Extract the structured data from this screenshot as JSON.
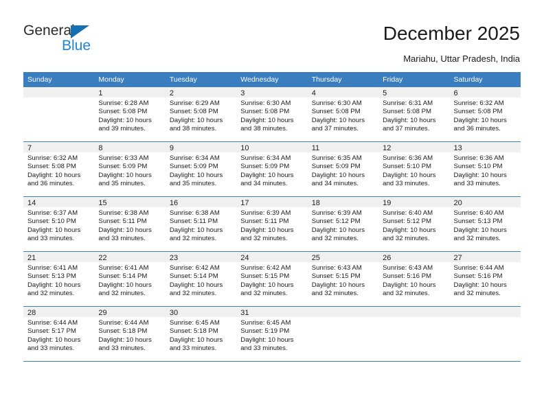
{
  "brand": {
    "name_top": "General",
    "name_bottom": "Blue",
    "accent_color": "#1b85d6",
    "triangle_color": "#146fb4"
  },
  "header": {
    "title": "December 2025",
    "subtitle": "Mariahu, Uttar Pradesh, India"
  },
  "calendar": {
    "header_color": "#3a7ebf",
    "weekday_headers": [
      "Sunday",
      "Monday",
      "Tuesday",
      "Wednesday",
      "Thursday",
      "Friday",
      "Saturday"
    ],
    "weeks": [
      [
        {
          "day": "",
          "sunrise": "",
          "sunset": "",
          "daylight": ""
        },
        {
          "day": "1",
          "sunrise": "Sunrise: 6:28 AM",
          "sunset": "Sunset: 5:08 PM",
          "daylight": "Daylight: 10 hours and 39 minutes."
        },
        {
          "day": "2",
          "sunrise": "Sunrise: 6:29 AM",
          "sunset": "Sunset: 5:08 PM",
          "daylight": "Daylight: 10 hours and 38 minutes."
        },
        {
          "day": "3",
          "sunrise": "Sunrise: 6:30 AM",
          "sunset": "Sunset: 5:08 PM",
          "daylight": "Daylight: 10 hours and 38 minutes."
        },
        {
          "day": "4",
          "sunrise": "Sunrise: 6:30 AM",
          "sunset": "Sunset: 5:08 PM",
          "daylight": "Daylight: 10 hours and 37 minutes."
        },
        {
          "day": "5",
          "sunrise": "Sunrise: 6:31 AM",
          "sunset": "Sunset: 5:08 PM",
          "daylight": "Daylight: 10 hours and 37 minutes."
        },
        {
          "day": "6",
          "sunrise": "Sunrise: 6:32 AM",
          "sunset": "Sunset: 5:08 PM",
          "daylight": "Daylight: 10 hours and 36 minutes."
        }
      ],
      [
        {
          "day": "7",
          "sunrise": "Sunrise: 6:32 AM",
          "sunset": "Sunset: 5:08 PM",
          "daylight": "Daylight: 10 hours and 36 minutes."
        },
        {
          "day": "8",
          "sunrise": "Sunrise: 6:33 AM",
          "sunset": "Sunset: 5:09 PM",
          "daylight": "Daylight: 10 hours and 35 minutes."
        },
        {
          "day": "9",
          "sunrise": "Sunrise: 6:34 AM",
          "sunset": "Sunset: 5:09 PM",
          "daylight": "Daylight: 10 hours and 35 minutes."
        },
        {
          "day": "10",
          "sunrise": "Sunrise: 6:34 AM",
          "sunset": "Sunset: 5:09 PM",
          "daylight": "Daylight: 10 hours and 34 minutes."
        },
        {
          "day": "11",
          "sunrise": "Sunrise: 6:35 AM",
          "sunset": "Sunset: 5:09 PM",
          "daylight": "Daylight: 10 hours and 34 minutes."
        },
        {
          "day": "12",
          "sunrise": "Sunrise: 6:36 AM",
          "sunset": "Sunset: 5:10 PM",
          "daylight": "Daylight: 10 hours and 33 minutes."
        },
        {
          "day": "13",
          "sunrise": "Sunrise: 6:36 AM",
          "sunset": "Sunset: 5:10 PM",
          "daylight": "Daylight: 10 hours and 33 minutes."
        }
      ],
      [
        {
          "day": "14",
          "sunrise": "Sunrise: 6:37 AM",
          "sunset": "Sunset: 5:10 PM",
          "daylight": "Daylight: 10 hours and 33 minutes."
        },
        {
          "day": "15",
          "sunrise": "Sunrise: 6:38 AM",
          "sunset": "Sunset: 5:11 PM",
          "daylight": "Daylight: 10 hours and 33 minutes."
        },
        {
          "day": "16",
          "sunrise": "Sunrise: 6:38 AM",
          "sunset": "Sunset: 5:11 PM",
          "daylight": "Daylight: 10 hours and 32 minutes."
        },
        {
          "day": "17",
          "sunrise": "Sunrise: 6:39 AM",
          "sunset": "Sunset: 5:11 PM",
          "daylight": "Daylight: 10 hours and 32 minutes."
        },
        {
          "day": "18",
          "sunrise": "Sunrise: 6:39 AM",
          "sunset": "Sunset: 5:12 PM",
          "daylight": "Daylight: 10 hours and 32 minutes."
        },
        {
          "day": "19",
          "sunrise": "Sunrise: 6:40 AM",
          "sunset": "Sunset: 5:12 PM",
          "daylight": "Daylight: 10 hours and 32 minutes."
        },
        {
          "day": "20",
          "sunrise": "Sunrise: 6:40 AM",
          "sunset": "Sunset: 5:13 PM",
          "daylight": "Daylight: 10 hours and 32 minutes."
        }
      ],
      [
        {
          "day": "21",
          "sunrise": "Sunrise: 6:41 AM",
          "sunset": "Sunset: 5:13 PM",
          "daylight": "Daylight: 10 hours and 32 minutes."
        },
        {
          "day": "22",
          "sunrise": "Sunrise: 6:41 AM",
          "sunset": "Sunset: 5:14 PM",
          "daylight": "Daylight: 10 hours and 32 minutes."
        },
        {
          "day": "23",
          "sunrise": "Sunrise: 6:42 AM",
          "sunset": "Sunset: 5:14 PM",
          "daylight": "Daylight: 10 hours and 32 minutes."
        },
        {
          "day": "24",
          "sunrise": "Sunrise: 6:42 AM",
          "sunset": "Sunset: 5:15 PM",
          "daylight": "Daylight: 10 hours and 32 minutes."
        },
        {
          "day": "25",
          "sunrise": "Sunrise: 6:43 AM",
          "sunset": "Sunset: 5:15 PM",
          "daylight": "Daylight: 10 hours and 32 minutes."
        },
        {
          "day": "26",
          "sunrise": "Sunrise: 6:43 AM",
          "sunset": "Sunset: 5:16 PM",
          "daylight": "Daylight: 10 hours and 32 minutes."
        },
        {
          "day": "27",
          "sunrise": "Sunrise: 6:44 AM",
          "sunset": "Sunset: 5:16 PM",
          "daylight": "Daylight: 10 hours and 32 minutes."
        }
      ],
      [
        {
          "day": "28",
          "sunrise": "Sunrise: 6:44 AM",
          "sunset": "Sunset: 5:17 PM",
          "daylight": "Daylight: 10 hours and 33 minutes."
        },
        {
          "day": "29",
          "sunrise": "Sunrise: 6:44 AM",
          "sunset": "Sunset: 5:18 PM",
          "daylight": "Daylight: 10 hours and 33 minutes."
        },
        {
          "day": "30",
          "sunrise": "Sunrise: 6:45 AM",
          "sunset": "Sunset: 5:18 PM",
          "daylight": "Daylight: 10 hours and 33 minutes."
        },
        {
          "day": "31",
          "sunrise": "Sunrise: 6:45 AM",
          "sunset": "Sunset: 5:19 PM",
          "daylight": "Daylight: 10 hours and 33 minutes."
        },
        {
          "day": "",
          "sunrise": "",
          "sunset": "",
          "daylight": ""
        },
        {
          "day": "",
          "sunrise": "",
          "sunset": "",
          "daylight": ""
        },
        {
          "day": "",
          "sunrise": "",
          "sunset": "",
          "daylight": ""
        }
      ]
    ]
  }
}
